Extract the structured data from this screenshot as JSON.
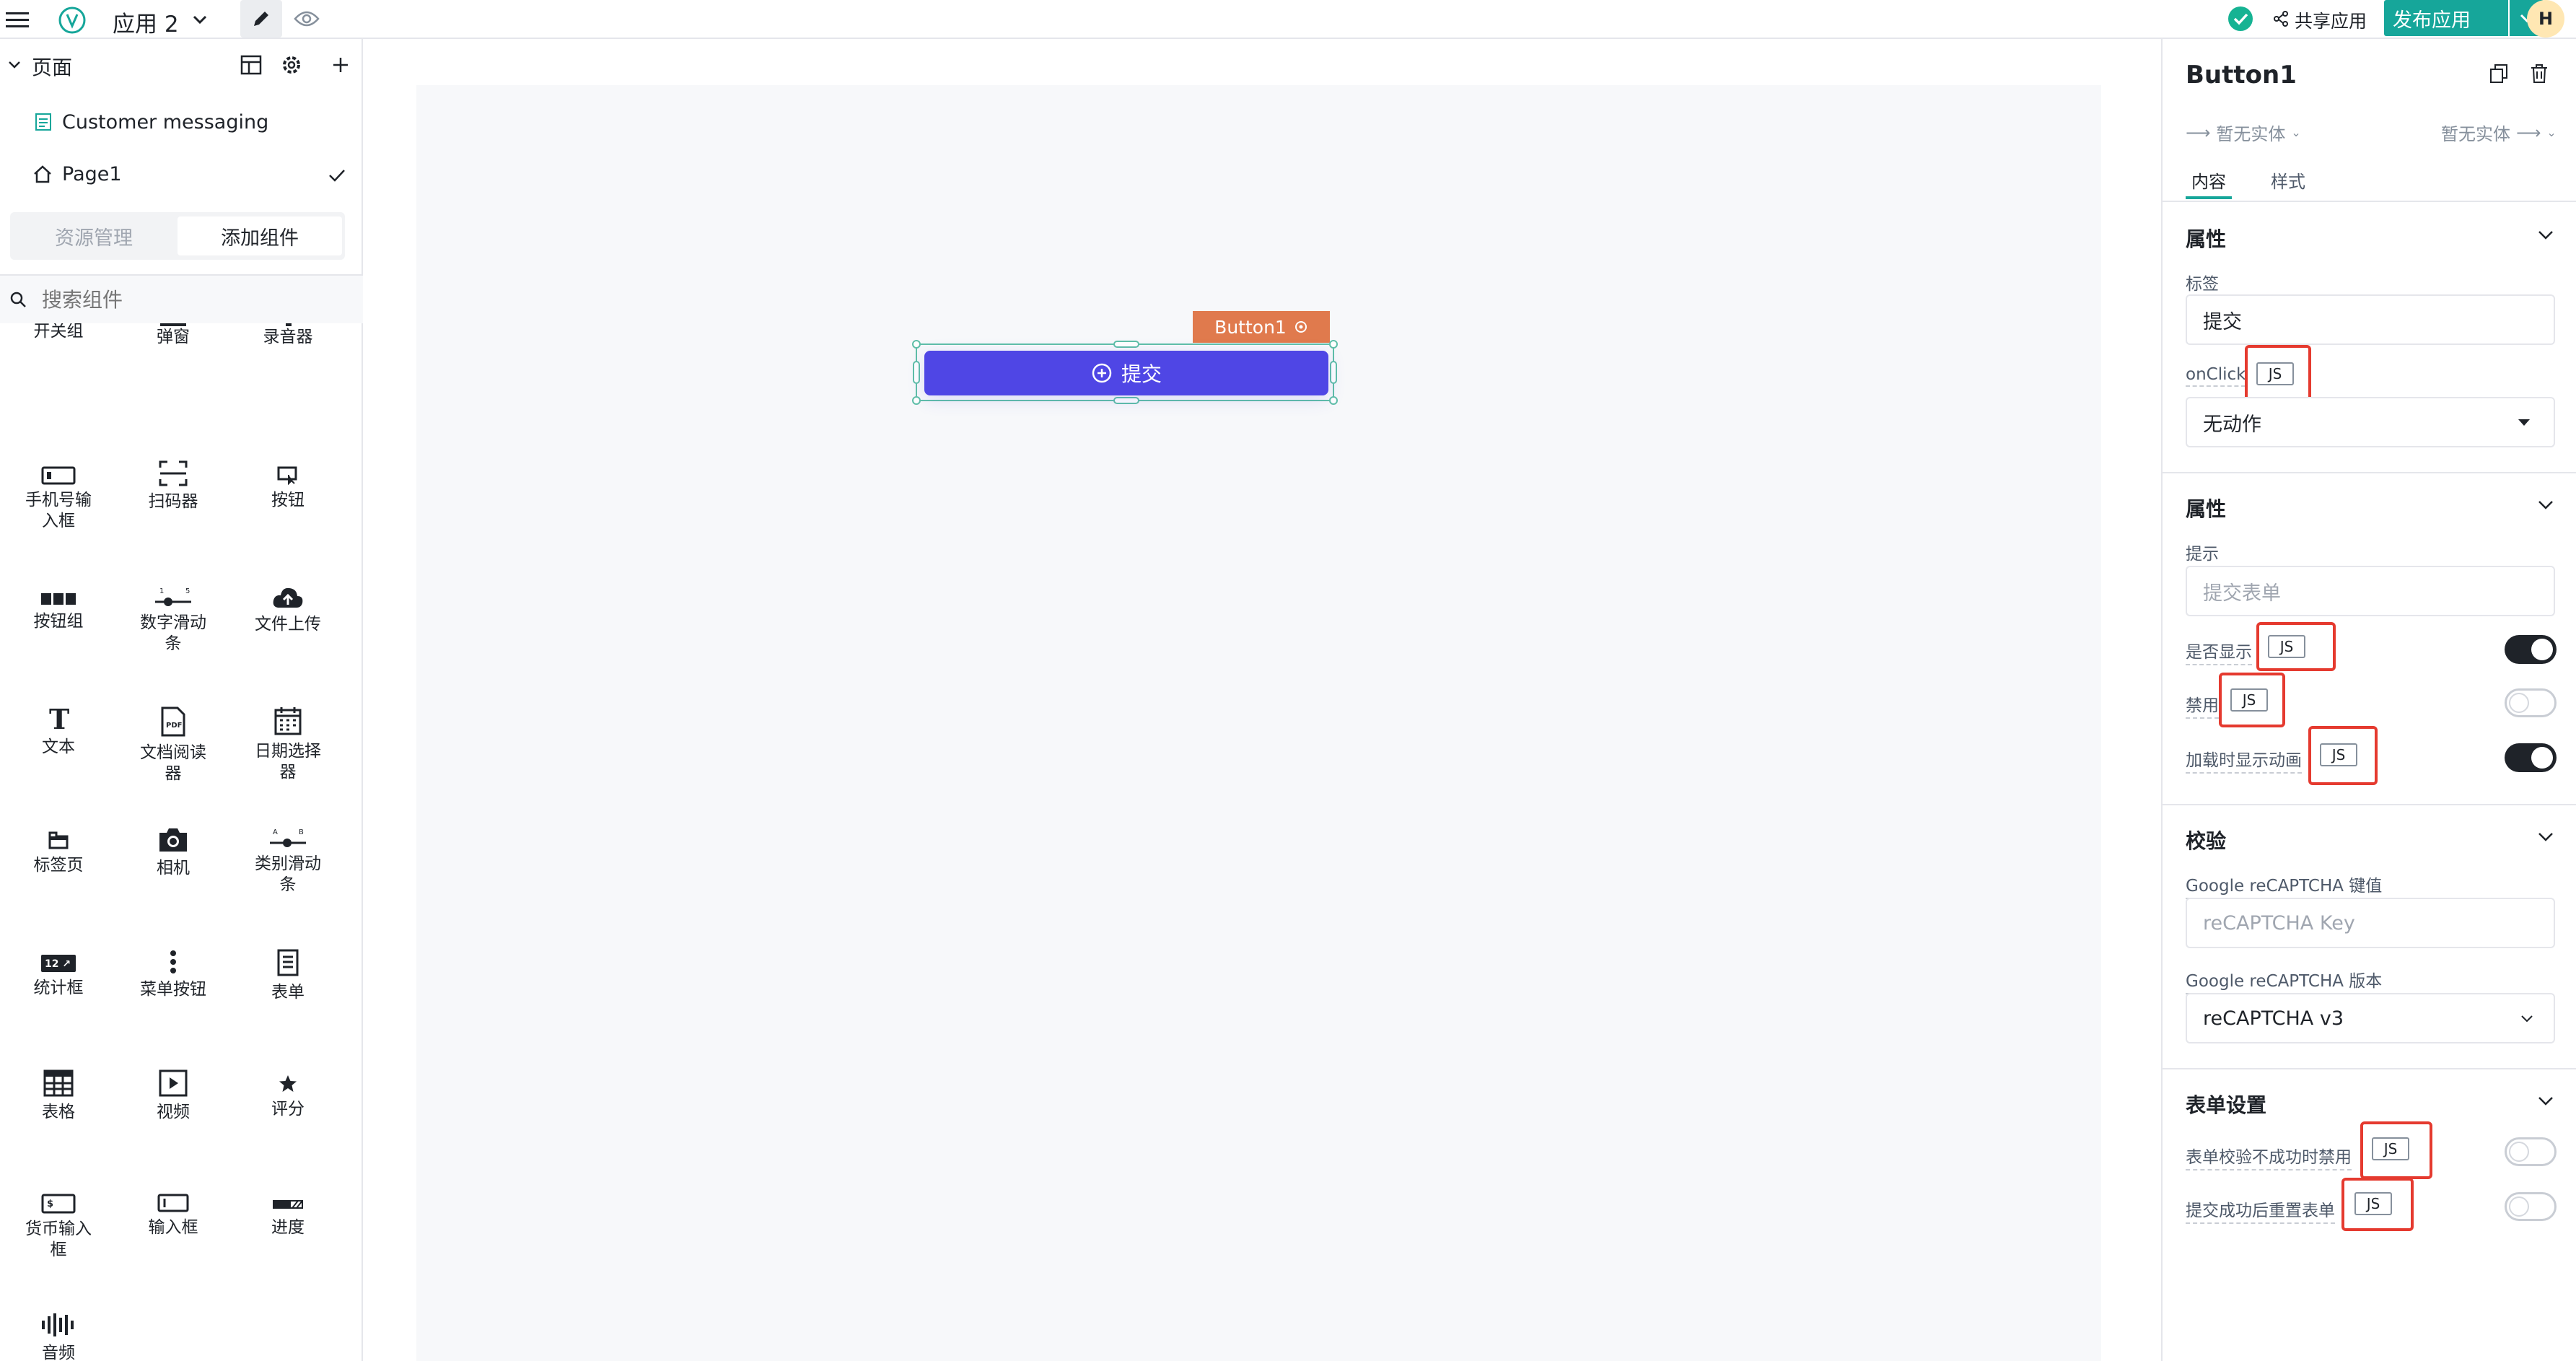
{
  "topbar": {
    "app_name": "应用 2",
    "share_label": "共享应用",
    "publish_label": "发布应用",
    "avatar_letter": "H"
  },
  "left": {
    "pages_title": "页面",
    "pages": [
      {
        "label": "Customer messaging"
      },
      {
        "label": "Page1"
      }
    ],
    "tabs": {
      "resources": "资源管理",
      "add_component": "添加组件"
    },
    "search_placeholder": "搜索组件",
    "components": [
      {
        "label": "开关组",
        "icon": "switch-group-icon"
      },
      {
        "label": "弹窗",
        "icon": "modal-icon"
      },
      {
        "label": "录音器",
        "icon": "recorder-icon"
      },
      {
        "label": "手机号输入框",
        "icon": "phone-input-icon"
      },
      {
        "label": "扫码器",
        "icon": "scanner-icon"
      },
      {
        "label": "按钮",
        "icon": "button-icon"
      },
      {
        "label": "按钮组",
        "icon": "button-group-icon"
      },
      {
        "label": "数字滑动条",
        "icon": "number-slider-icon"
      },
      {
        "label": "文件上传",
        "icon": "file-upload-icon"
      },
      {
        "label": "文本",
        "icon": "text-icon"
      },
      {
        "label": "文档阅读器",
        "icon": "pdf-reader-icon"
      },
      {
        "label": "日期选择器",
        "icon": "date-picker-icon"
      },
      {
        "label": "标签页",
        "icon": "tabs-icon"
      },
      {
        "label": "相机",
        "icon": "camera-icon"
      },
      {
        "label": "类别滑动条",
        "icon": "category-slider-icon"
      },
      {
        "label": "统计框",
        "icon": "statistic-icon"
      },
      {
        "label": "菜单按钮",
        "icon": "menu-button-icon"
      },
      {
        "label": "表单",
        "icon": "form-icon"
      },
      {
        "label": "表格",
        "icon": "table-icon"
      },
      {
        "label": "视频",
        "icon": "video-icon"
      },
      {
        "label": "评分",
        "icon": "rating-icon"
      },
      {
        "label": "货币输入框",
        "icon": "currency-input-icon"
      },
      {
        "label": "输入框",
        "icon": "input-icon"
      },
      {
        "label": "进度",
        "icon": "progress-icon"
      },
      {
        "label": "音频",
        "icon": "audio-icon"
      }
    ],
    "component_line_breaks": {
      "手机号输入框": [
        "手机号输",
        "入框"
      ],
      "数字滑动条": [
        "数字滑动",
        "条"
      ],
      "文档阅读器": [
        "文档阅读",
        "器"
      ],
      "日期选择器": [
        "日期选择",
        "器"
      ],
      "类别滑动条": [
        "类别滑动",
        "条"
      ],
      "货币输入框": [
        "货币输入",
        "框"
      ]
    }
  },
  "canvas": {
    "widget_tag": "Button1",
    "button_label": "提交"
  },
  "inspector": {
    "title": "Button1",
    "entity_left": "暂无实体",
    "entity_right": "暂无实体",
    "tabs": [
      "内容",
      "样式"
    ],
    "sections": {
      "props1": {
        "title": "属性",
        "label_caption": "标签",
        "label_value": "提交",
        "onclick_caption": "onClick",
        "onclick_value": "无动作"
      },
      "props2": {
        "title": "属性",
        "tooltip_caption": "提示",
        "tooltip_placeholder": "提交表单",
        "visible_caption": "是否显示",
        "disabled_caption": "禁用",
        "loading_caption": "加载时显示动画"
      },
      "validation": {
        "title": "校验",
        "key_caption": "Google reCAPTCHA 键值",
        "key_placeholder": "reCAPTCHA Key",
        "version_caption": "Google reCAPTCHA 版本",
        "version_value": "reCAPTCHA v3"
      },
      "form": {
        "title": "表单设置",
        "disable_invalid_caption": "表单校验不成功时禁用",
        "reset_caption": "提交成功后重置表单"
      }
    },
    "js_label": "JS",
    "toggles": {
      "visible": true,
      "disabled": false,
      "loading": true,
      "disable_invalid": false,
      "reset": false
    }
  },
  "colors": {
    "primary_button": "#4f46e5",
    "widget_tag": "#e07a4d",
    "publish": "#16a69a",
    "highlight_box": "#e53a2f"
  }
}
